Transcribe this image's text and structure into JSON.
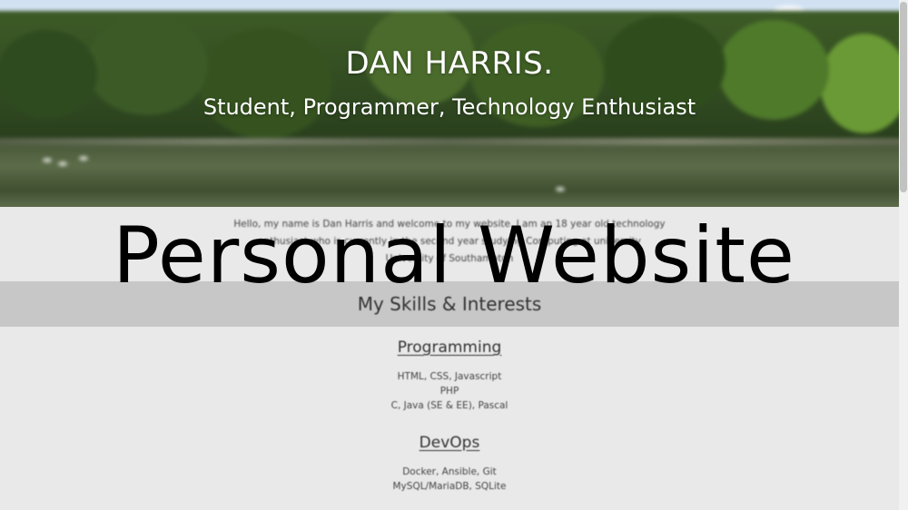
{
  "hero": {
    "name": "DAN HARRIS.",
    "tagline": "Student, Programmer, Technology Enthusiast"
  },
  "about": {
    "lines": [
      "Hello, my name is Dan Harris and welcome to my website. I am an 18 year old technology",
      "enthusiast who is currently in the second year studying Computing at university",
      "University of Southampton"
    ]
  },
  "skills": {
    "title": "My Skills & Interests",
    "sections": [
      {
        "heading": "Programming",
        "items": [
          "HTML, CSS, Javascript",
          "PHP",
          "C, Java (SE & EE), Pascal"
        ]
      },
      {
        "heading": "DevOps",
        "items": [
          "Docker, Ansible, Git",
          "MySQL/MariaDB, SQLite"
        ]
      }
    ]
  },
  "overlay": {
    "title": "Personal Website"
  },
  "colors": {
    "page_background": "#e9e9e9",
    "band_background": "#c7c7c7",
    "hero_text": "#ffffff",
    "overlay_text": "#000000"
  }
}
